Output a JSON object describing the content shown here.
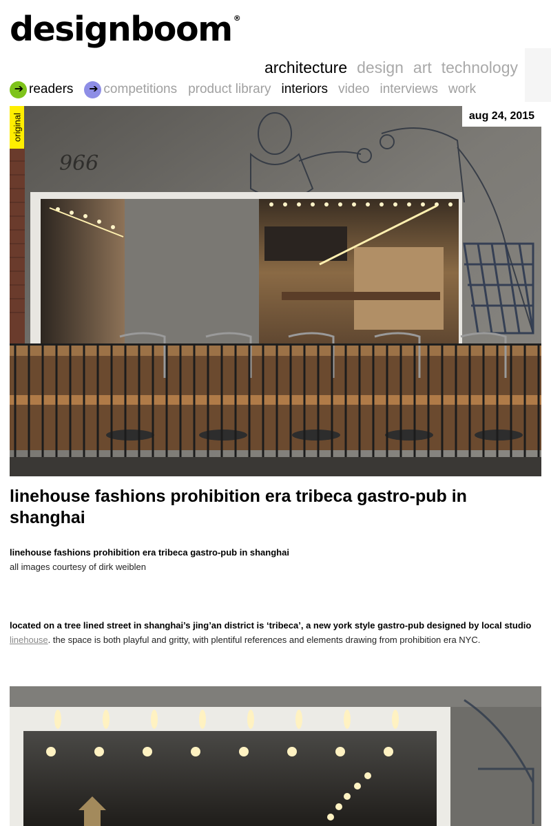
{
  "logo": {
    "text": "designboom",
    "mark": "®"
  },
  "section_nav": [
    "architecture",
    "design",
    "art",
    "technology"
  ],
  "sub_nav": {
    "readers": "readers",
    "competitions": "competitions",
    "items": [
      "product library",
      "interiors",
      "video",
      "interviews",
      "work"
    ]
  },
  "article": {
    "tag": "original",
    "date": "aug 24, 2015",
    "title": "linehouse fashions prohibition era tribeca gastro-pub in shanghai",
    "subtitle": "linehouse fashions prohibition era tribeca gastro-pub in shanghai",
    "credit": "all images courtesy of dirk weiblen",
    "body_lead": "located on a tree lined street in shanghai’s jing’an district is ‘tribeca’, a new york style gastro-pub designed by local studio",
    "body_link": "linehouse",
    "body_rest": ". the space is both playful and gritty, with plentiful references and elements drawing from prohibition era NYC.",
    "sign_text": "966"
  },
  "colors": {
    "readers_circle": "#7ec31a",
    "competitions_circle": "#8e8ee6",
    "tag_yellow": "#ffee00"
  }
}
